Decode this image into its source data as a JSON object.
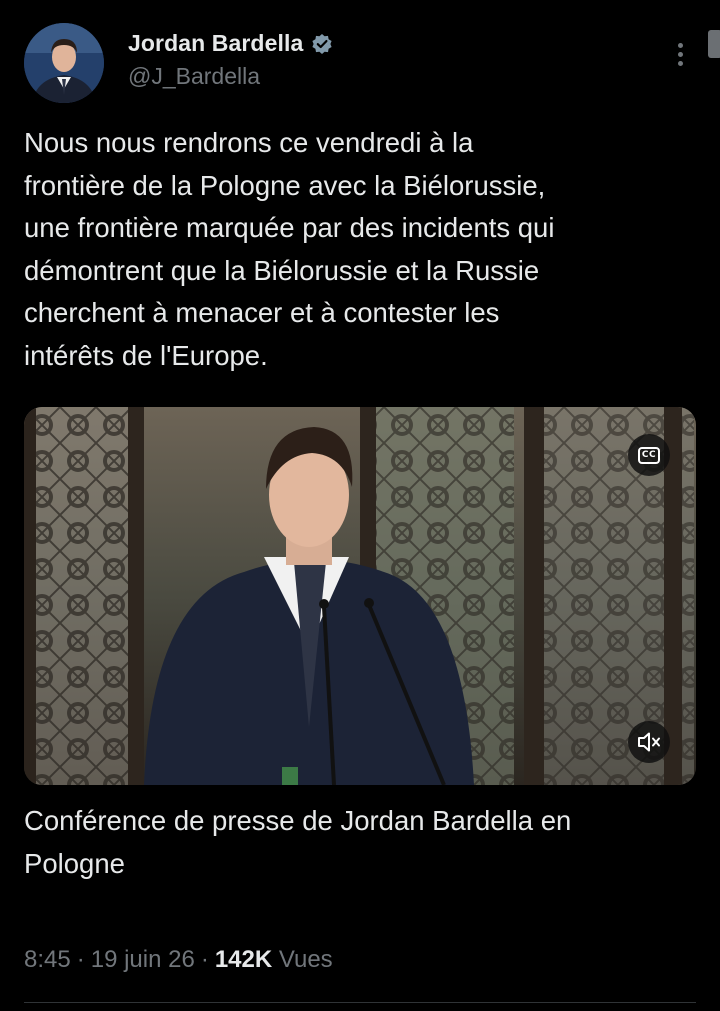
{
  "author": {
    "display_name": "Jordan Bardella",
    "handle": "@J_Bardella",
    "verified": true,
    "verified_color": "#829aab"
  },
  "tweet": {
    "text": "Nous nous rendrons ce vendredi à la\nfrontière de la Pologne avec la Biélorussie,\nune frontière marquée par des incidents qui\ndémontrent que la Biélorussie et la Russie\ncherchent à menacer et à contester les\nintérêts de l'Europe."
  },
  "media": {
    "type": "video",
    "captions_label": "CC",
    "caption": "Conférence de presse de Jordan Bardella en\nPologne"
  },
  "meta": {
    "time": "8:45",
    "separator": "·",
    "date": "19 juin 26",
    "views_count": "142K",
    "views_label": "Vues"
  },
  "icons": {
    "more": "more-vertical-icon",
    "verified": "verified-badge-icon",
    "captions": "closed-captions-icon",
    "mute": "volume-muted-icon"
  }
}
